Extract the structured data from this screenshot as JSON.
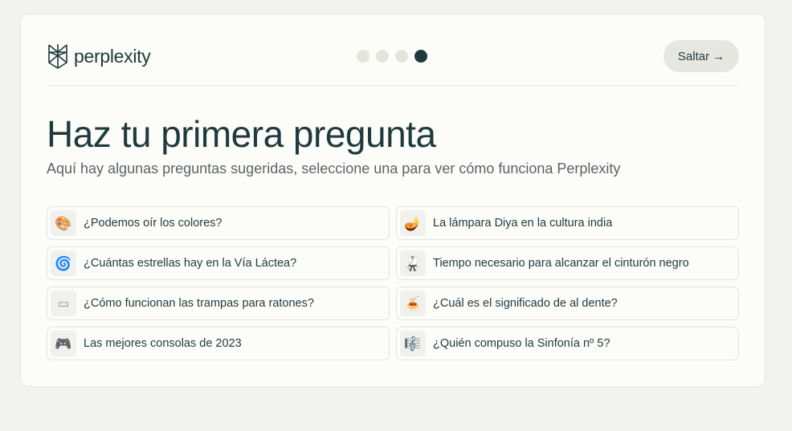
{
  "brand": {
    "name": "perplexity"
  },
  "progress": {
    "total_steps": 4,
    "current_step": 4
  },
  "header": {
    "skip_label": "Saltar",
    "skip_arrow": "→"
  },
  "main": {
    "title": "Haz tu primera pregunta",
    "subtitle": "Aquí hay algunas preguntas sugeridas, seleccione una para ver cómo funciona Perplexity"
  },
  "questions": [
    {
      "icon": "🎨",
      "icon_name": "palette-icon",
      "text": "¿Podemos oír los colores?"
    },
    {
      "icon": "🪔",
      "icon_name": "diya-lamp-icon",
      "text": "La lámpara Diya en la cultura india"
    },
    {
      "icon": "🌀",
      "icon_name": "galaxy-icon",
      "text": "¿Cuántas estrellas hay en la Vía Láctea?"
    },
    {
      "icon": "🥋",
      "icon_name": "martial-arts-uniform-icon",
      "text": "Tiempo necesario para alcanzar el cinturón negro"
    },
    {
      "icon": "▭",
      "icon_name": "mousetrap-icon",
      "text": "¿Cómo funcionan las trampas para ratones?"
    },
    {
      "icon": "🍝",
      "icon_name": "pasta-icon",
      "text": "¿Cuál es el significado de al dente?"
    },
    {
      "icon": "🎮",
      "icon_name": "game-controller-icon",
      "text": "Las mejores consolas de 2023"
    },
    {
      "icon": "🎼",
      "icon_name": "musical-score-icon",
      "text": "¿Quién compuso la Sinfonía nº 5?"
    }
  ]
}
